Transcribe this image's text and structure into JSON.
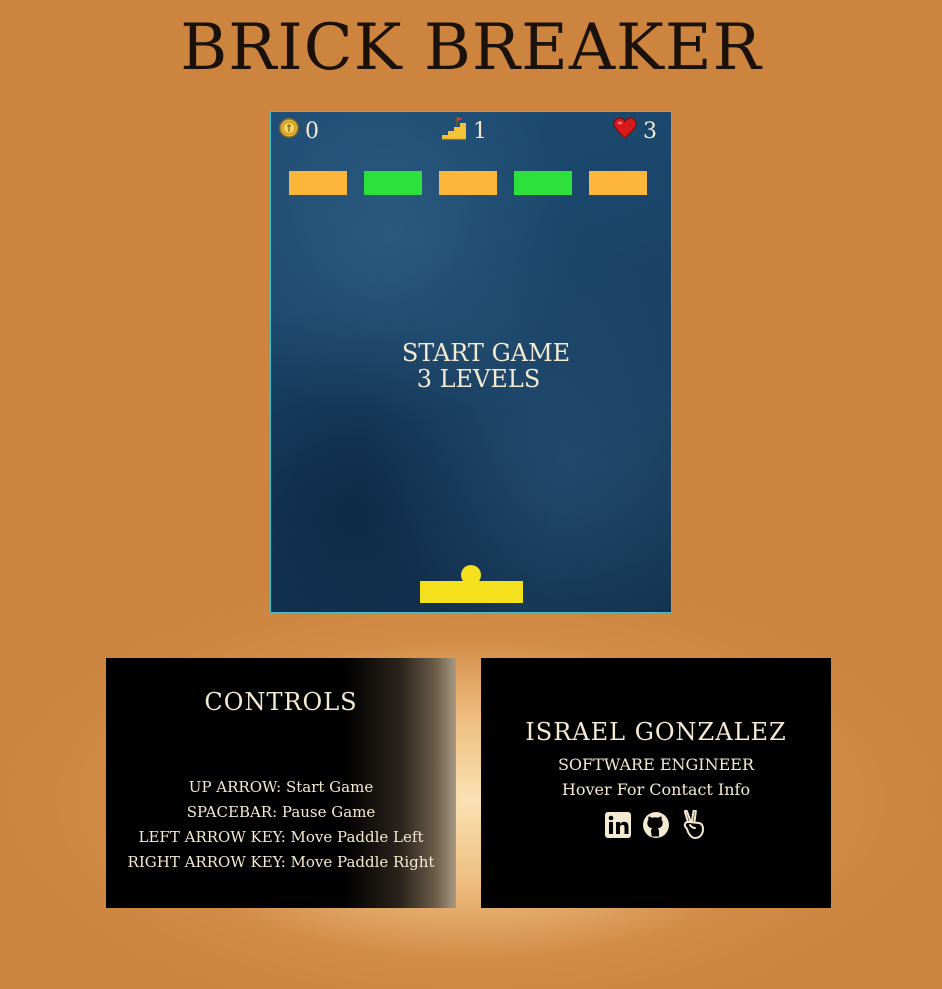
{
  "header": {
    "title": "BRICK BREAKER"
  },
  "hud": {
    "score": "0",
    "level": "1",
    "lives": "3",
    "score_icon": "coin-icon",
    "level_icon": "stairs-flag-icon",
    "lives_icon": "heart-icon"
  },
  "bricks": [
    {
      "color": "#fcb73a"
    },
    {
      "color": "#2de03c"
    },
    {
      "color": "#fcb73a"
    },
    {
      "color": "#2de03c"
    },
    {
      "color": "#fcb73a"
    }
  ],
  "overlay": {
    "line1": "START GAME",
    "line2": "3 LEVELS"
  },
  "colors": {
    "paddle": "#f4e01c",
    "ball": "#f4e01c",
    "background": "#cc843f",
    "board_border": "#3fc1c9"
  },
  "controls": {
    "title": "CONTROLS",
    "items": [
      "UP ARROW: Start Game",
      "SPACEBAR: Pause Game",
      "LEFT ARROW KEY: Move Paddle Left",
      "RIGHT ARROW KEY: Move Paddle Right"
    ]
  },
  "about": {
    "name": "ISRAEL GONZALEZ",
    "role": "SOFTWARE ENGINEER",
    "hover_hint": "Hover For Contact Info",
    "socials": [
      {
        "icon": "linkedin-icon"
      },
      {
        "icon": "github-icon"
      },
      {
        "icon": "angellist-icon"
      }
    ]
  }
}
